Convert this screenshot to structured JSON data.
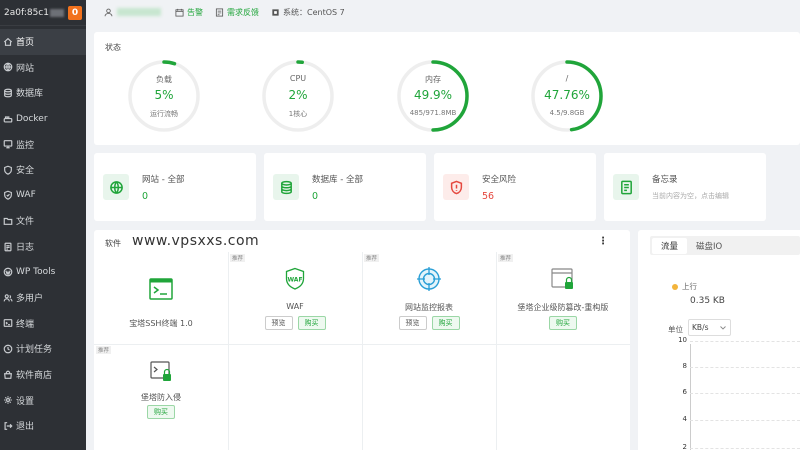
{
  "sidebar": {
    "hostname": "2a0f:85c1",
    "badge": "0",
    "items": [
      {
        "label": "首页",
        "icon": "home-icon"
      },
      {
        "label": "网站",
        "icon": "globe-icon"
      },
      {
        "label": "数据库",
        "icon": "database-icon"
      },
      {
        "label": "Docker",
        "icon": "docker-icon"
      },
      {
        "label": "监控",
        "icon": "monitor-icon"
      },
      {
        "label": "安全",
        "icon": "shield-icon"
      },
      {
        "label": "WAF",
        "icon": "waf-icon"
      },
      {
        "label": "文件",
        "icon": "folder-icon"
      },
      {
        "label": "日志",
        "icon": "log-icon"
      },
      {
        "label": "WP Tools",
        "icon": "wordpress-icon"
      },
      {
        "label": "多用户",
        "icon": "users-icon"
      },
      {
        "label": "终端",
        "icon": "terminal-icon"
      },
      {
        "label": "计划任务",
        "icon": "clock-icon"
      },
      {
        "label": "软件商店",
        "icon": "store-icon"
      },
      {
        "label": "设置",
        "icon": "gear-icon"
      },
      {
        "label": "退出",
        "icon": "logout-icon"
      }
    ]
  },
  "topbar": {
    "alert_label": "告警",
    "feedback_label": "需求反馈",
    "system_label": "系统：CentOS 7"
  },
  "status": {
    "title": "状态",
    "gauges": [
      {
        "label": "负载",
        "value": "5%",
        "sub": "运行流畅",
        "percent": 5
      },
      {
        "label": "CPU",
        "value": "2%",
        "sub": "1核心",
        "percent": 2
      },
      {
        "label": "内存",
        "value": "49.9%",
        "sub": "485/971.8MB",
        "percent": 49.9
      },
      {
        "label": "/",
        "value": "47.76%",
        "sub": "4.5/9.8GB",
        "percent": 47.76
      }
    ],
    "colors": {
      "accent": "#20a53a",
      "track": "#eeeeee"
    }
  },
  "overview": [
    {
      "name": "网站 - 全部",
      "value": "0",
      "icon": "globe-icon"
    },
    {
      "name": "数据库 - 全部",
      "value": "0",
      "icon": "database-icon"
    },
    {
      "name": "安全风险",
      "value": "56",
      "icon": "warning-shield-icon"
    },
    {
      "name": "备忘录",
      "value": "当前内容为空，点击编辑",
      "icon": "memo-icon"
    }
  ],
  "software": {
    "title": "软件",
    "watermark": "www.vpsxxs.com",
    "items": [
      {
        "name": "宝塔SSH终端 1.0",
        "tag": "",
        "buttons": []
      },
      {
        "name": "WAF",
        "tag": "推荐",
        "buttons": [
          "预览",
          "购买"
        ]
      },
      {
        "name": "网站监控报表",
        "tag": "推荐",
        "buttons": [
          "预览",
          "购买"
        ]
      },
      {
        "name": "堡塔企业级防篡改-重构版",
        "tag": "推荐",
        "buttons": [
          "购买"
        ]
      },
      {
        "name": "堡塔防入侵",
        "tag": "推荐",
        "buttons": [
          "购买"
        ]
      }
    ]
  },
  "traffic": {
    "tabs": [
      "流量",
      "磁盘IO"
    ],
    "up_label": "上行",
    "up_value": "0.35 KB",
    "unit_label": "单位",
    "unit_value": "KB/s",
    "y_ticks": [
      "10",
      "8",
      "6",
      "4",
      "2"
    ]
  }
}
